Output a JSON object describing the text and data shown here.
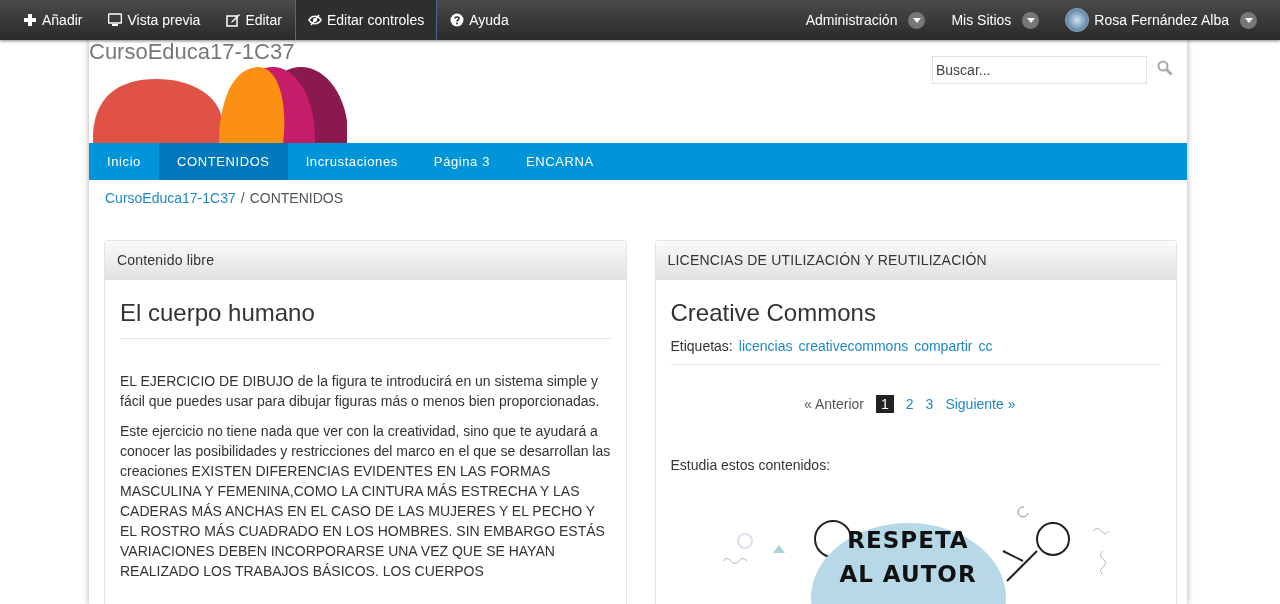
{
  "toolbar": {
    "left": [
      {
        "label": "Añadir",
        "kind": "add",
        "active": false
      },
      {
        "label": "Vista previa",
        "kind": "preview",
        "active": false
      },
      {
        "label": "Editar",
        "kind": "edit",
        "active": false
      },
      {
        "label": "Editar controles",
        "kind": "controls",
        "active": true
      },
      {
        "label": "Ayuda",
        "kind": "help",
        "active": false
      }
    ],
    "right": [
      {
        "label": "Administración",
        "avatar": false
      },
      {
        "label": "Mis Sitios",
        "avatar": false
      },
      {
        "label": "Rosa Fernández Alba",
        "avatar": true
      }
    ]
  },
  "site": {
    "title": "CursoEduca17-1C37",
    "search": {
      "placeholder": "Buscar..."
    }
  },
  "nav": [
    {
      "label": "Inicio",
      "selected": false
    },
    {
      "label": "CONTENIDOS",
      "selected": true
    },
    {
      "label": "Incrustaciones",
      "selected": false
    },
    {
      "label": "Página 3",
      "selected": false
    },
    {
      "label": "ENCARNA",
      "selected": false
    }
  ],
  "breadcrumb": {
    "link": "CursoEduca17-1C37",
    "separator": "/",
    "current": "CONTENIDOS"
  },
  "left_panel": {
    "header": "Contenido libre",
    "title": "El cuerpo humano",
    "paragraphs": [
      "EL EJERCICIO DE DIBUJO de la figura te introducirá en un sistema simple y fácil que puedes usar para dibujar figuras más o menos bien proporcionadas.",
      "Este ejercicio no tiene nada que ver con la creatividad, sino que te ayudará a conocer las posibilidades y restricciones del marco en el que se desarrollan las creaciones EXISTEN DIFERENCIAS EVIDENTES EN LAS FORMAS MASCULINA Y FEMENINA,COMO LA CINTURA MÁS ESTRECHA Y LAS CADERAS MÁS ANCHAS EN EL CASO DE LAS MUJERES Y EL PECHO Y EL ROSTRO MÁS CUADRADO EN LOS HOMBRES. SIN EMBARGO ESTÁS VARIACIONES DEBEN INCORPORARSE UNA VEZ QUE SE HAYAN REALIZADO LOS TRABAJOS BÁSICOS. LOS CUERPOS"
    ]
  },
  "right_panel": {
    "header": "LICENCIAS DE UTILIZACIÓN Y REUTILIZACIÓN",
    "title": "Creative Commons",
    "tags_label": "Etiquetas:",
    "tags": [
      "licencias",
      "creativecommons",
      "compartir",
      "cc"
    ],
    "pagination": [
      {
        "label": "« Anterior",
        "selected": false,
        "kind": "text"
      },
      {
        "label": "1",
        "selected": true,
        "kind": "link"
      },
      {
        "label": "2",
        "selected": false,
        "kind": "link"
      },
      {
        "label": "3",
        "selected": false,
        "kind": "link"
      },
      {
        "label": "Siguiente »",
        "selected": false,
        "kind": "link"
      }
    ],
    "intro": "Estudia estos contenidos:",
    "illustration": {
      "lines": [
        "RESPETA",
        "AL AUTOR"
      ]
    }
  }
}
